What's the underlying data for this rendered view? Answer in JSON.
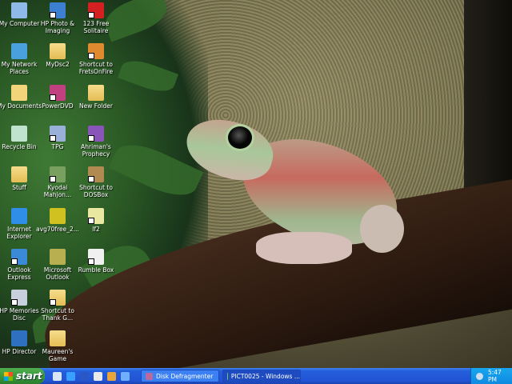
{
  "desktop": {
    "icons": [
      {
        "label": "My Computer",
        "col": 0,
        "row": 0,
        "icon": "computer-icon",
        "shortcut": false
      },
      {
        "label": "HP Photo & Imaging",
        "col": 1,
        "row": 0,
        "icon": "hp-photo-icon",
        "shortcut": true
      },
      {
        "label": "123 Free Solitaire",
        "col": 2,
        "row": 0,
        "icon": "cards-icon",
        "shortcut": true
      },
      {
        "label": "My Network Places",
        "col": 0,
        "row": 1,
        "icon": "network-icon",
        "shortcut": false
      },
      {
        "label": "MyDsc2",
        "col": 1,
        "row": 1,
        "icon": "folder-icon",
        "shortcut": false
      },
      {
        "label": "Shortcut to FretsOnFire",
        "col": 2,
        "row": 1,
        "icon": "guitar-icon",
        "shortcut": true
      },
      {
        "label": "My Documents",
        "col": 0,
        "row": 2,
        "icon": "documents-icon",
        "shortcut": false
      },
      {
        "label": "PowerDVD",
        "col": 1,
        "row": 2,
        "icon": "dvd-icon",
        "shortcut": true
      },
      {
        "label": "New Folder",
        "col": 2,
        "row": 2,
        "icon": "folder-icon",
        "shortcut": false
      },
      {
        "label": "Recycle Bin",
        "col": 0,
        "row": 3,
        "icon": "recycle-bin-icon",
        "shortcut": false
      },
      {
        "label": "TPG",
        "col": 1,
        "row": 3,
        "icon": "tpg-icon",
        "shortcut": true
      },
      {
        "label": "Ahriman's Prophecy",
        "col": 2,
        "row": 3,
        "icon": "game-icon",
        "shortcut": true
      },
      {
        "label": "Stuff",
        "col": 0,
        "row": 4,
        "icon": "folder-icon",
        "shortcut": false
      },
      {
        "label": "Kyodai Mahjon...",
        "col": 1,
        "row": 4,
        "icon": "mahjong-icon",
        "shortcut": true
      },
      {
        "label": "Shortcut to DOSBox",
        "col": 2,
        "row": 4,
        "icon": "dosbox-icon",
        "shortcut": true
      },
      {
        "label": "Internet Explorer",
        "col": 0,
        "row": 5,
        "icon": "internet-explorer-icon",
        "shortcut": false
      },
      {
        "label": "avg70free_2...",
        "col": 1,
        "row": 5,
        "icon": "installer-icon",
        "shortcut": false
      },
      {
        "label": "lf2",
        "col": 2,
        "row": 5,
        "icon": "lf2-icon",
        "shortcut": true
      },
      {
        "label": "Outlook Express",
        "col": 0,
        "row": 6,
        "icon": "outlook-express-icon",
        "shortcut": true
      },
      {
        "label": "Microsoft Outlook",
        "col": 1,
        "row": 6,
        "icon": "outlook-icon",
        "shortcut": false
      },
      {
        "label": "Rumble Box",
        "col": 2,
        "row": 6,
        "icon": "rumble-box-icon",
        "shortcut": true
      },
      {
        "label": "HP Memories Disc",
        "col": 0,
        "row": 7,
        "icon": "hp-memories-icon",
        "shortcut": true
      },
      {
        "label": "Shortcut to Thank G...",
        "col": 1,
        "row": 7,
        "icon": "folder-icon",
        "shortcut": true
      },
      {
        "label": "HP Director",
        "col": 0,
        "row": 8,
        "icon": "hp-director-icon",
        "shortcut": false
      },
      {
        "label": "Maureen's Game",
        "col": 1,
        "row": 8,
        "icon": "folder-icon",
        "shortcut": false
      }
    ]
  },
  "taskbar": {
    "start_label": "start",
    "quick_launch": [
      {
        "icon": "show-desktop-icon",
        "color": "#d9e4f7"
      },
      {
        "icon": "internet-explorer-icon",
        "color": "#3aa0ff"
      },
      {
        "icon": "word-icon",
        "color": "#2b56c6"
      },
      {
        "icon": "media-player-icon",
        "color": "#eaeaea"
      },
      {
        "icon": "winamp-icon",
        "color": "#e8a63a"
      },
      {
        "icon": "messenger-icon",
        "color": "#6fb0ff"
      }
    ],
    "tasks": [
      {
        "label": "Disk Defragmenter",
        "icon": "defrag-icon",
        "color": "#b9699b",
        "active": false
      },
      {
        "label": "PICT0025 - Windows ...",
        "icon": "picture-viewer-icon",
        "color": "#6fbf6f",
        "active": true
      }
    ],
    "clock": "5:47 PM"
  }
}
